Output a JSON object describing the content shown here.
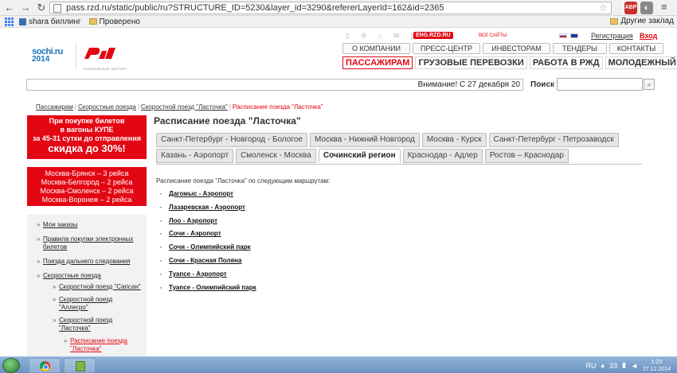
{
  "browser": {
    "url": "pass.rzd.ru/static/public/ru?STRUCTURE_ID=5230&layer_id=3290&refererLayerId=162&id=2365",
    "bookmarks": [
      "shara биллинг",
      "Проверено"
    ],
    "other_bookmarks": "Другие заклад",
    "ext_badge": "ABP"
  },
  "header": {
    "eng_label": "ENG.RZD.RU",
    "all_sites": "ВСЕ САЙТЫ",
    "register": "Регистрация",
    "login": "Вход",
    "logo_sochi": "sochi.ru",
    "logo_year": "2014",
    "partner_text": "ГЕНЕРАЛЬНЫЙ ПАРТНЕР",
    "top_nav": [
      "О КОМПАНИИ",
      "ПРЕСС-ЦЕНТР",
      "ИНВЕСТОРАМ",
      "ТЕНДЕРЫ",
      "КОНТАКТЫ"
    ],
    "main_nav": [
      "ПАССАЖИРАМ",
      "ГРУЗОВЫЕ ПЕРЕВОЗКИ",
      "РАБОТА В РЖД",
      "МОЛОДЕЖНЫЙ"
    ],
    "ticker": "Внимание! С 27 декабря 20",
    "search_label": "Поиск"
  },
  "breadcrumb": {
    "items": [
      "Пассажирам",
      "Скоростные поезда",
      "Скоростной поезд \"Ласточка\""
    ],
    "current": "Расписание поезда \"Ласточка\""
  },
  "promo": {
    "lines": [
      "При покупке билетов",
      "в вагоны КУПЕ",
      "за 45-31 сутки до отправления"
    ],
    "big": "скидка до 30%!"
  },
  "promo2": {
    "lines": [
      "Москва-Брянск – 3 рейса",
      "Москва-Белгород – 2 рейса",
      "Москва-Смоленск – 2 рейса",
      "Москва-Воронеж – 2 рейса"
    ]
  },
  "side_menu": {
    "items": [
      "Мои заказы",
      "Правила покупки электронных билетов",
      "Поезда дальнего следования",
      "Скоростные поезда"
    ],
    "sub_items": [
      "Скоростной поезд \"Сапсан\"",
      "Скоростной поезд \"Аллегро\"",
      "Скоростной поезд \"Ласточка\""
    ],
    "current": "Расписание поезда \"Ласточка\""
  },
  "content": {
    "title": "Расписание поезда \"Ласточка\"",
    "tabs_row1": [
      "Санкт-Петербург - Новгород - Бологое",
      "Москва - Нижний Новгород",
      "Москва - Курск",
      "Санкт-Петербург - Петрозаводск"
    ],
    "tabs_row2": [
      "Казань - Аэропорт",
      "Смоленск - Москва",
      "Сочинский регион",
      "Краснодар - Адлер",
      "Ростов – Краснодар"
    ],
    "active_tab": "Сочинский регион",
    "intro": "Расписание поезда \"Ласточка\" по следующим маршрутам:",
    "routes": [
      "Дагомыс - Аэропорт",
      "Лазаревская - Аэропорт",
      "Лоо - Аэропорт",
      "Сочи - Аэропорт",
      "Сочи - Олимпийский парк",
      "Сочи - Красная Поляна",
      "Туапсе - Аэропорт",
      "Туапсе - Олимпийский парк"
    ]
  },
  "taskbar": {
    "lang": "RU",
    "tray_num": "33",
    "time": "1:23",
    "date": "27.12.2014"
  }
}
